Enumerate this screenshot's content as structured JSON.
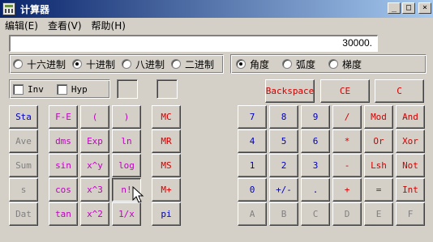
{
  "window": {
    "title": "计算器",
    "buttons": {
      "minimize": "_",
      "maximize": "□",
      "close": "×"
    }
  },
  "menu": [
    {
      "label": "编辑(E)"
    },
    {
      "label": "查看(V)"
    },
    {
      "label": "帮助(H)"
    }
  ],
  "display": {
    "value": "30000."
  },
  "number_system": {
    "options": [
      "十六进制",
      "十进制",
      "八进制",
      "二进制"
    ],
    "selected": "十进制"
  },
  "angle_unit": {
    "options": [
      "角度",
      "弧度",
      "梯度"
    ],
    "selected": "角度"
  },
  "modifiers": {
    "inv": "Inv",
    "hyp": "Hyp"
  },
  "colors": {
    "blue": "#0000c0",
    "red": "#d00000",
    "magenta": "#c000c0",
    "gray": "#808080"
  },
  "top_buttons": {
    "backspace": "Backspace",
    "ce": "CE",
    "c": "C"
  },
  "stat_buttons": [
    "Sta",
    "Ave",
    "Sum",
    "s",
    "Dat"
  ],
  "sci_col1": [
    "F-E",
    "dms",
    "sin",
    "cos",
    "tan"
  ],
  "sci_col2": [
    "(",
    "Exp",
    "x^y",
    "x^3",
    "x^2"
  ],
  "sci_col3": [
    ")",
    "ln",
    "log",
    "n!",
    "1/x"
  ],
  "memory_buttons": [
    "MC",
    "MR",
    "MS",
    "M+",
    "pi"
  ],
  "digit_rows": [
    [
      "7",
      "8",
      "9",
      "/",
      "Mod",
      "And"
    ],
    [
      "4",
      "5",
      "6",
      "*",
      "Or",
      "Xor"
    ],
    [
      "1",
      "2",
      "3",
      "-",
      "Lsh",
      "Not"
    ],
    [
      "0",
      "+/-",
      ".",
      "+",
      "=",
      "Int"
    ],
    [
      "A",
      "B",
      "C",
      "D",
      "E",
      "F"
    ]
  ]
}
